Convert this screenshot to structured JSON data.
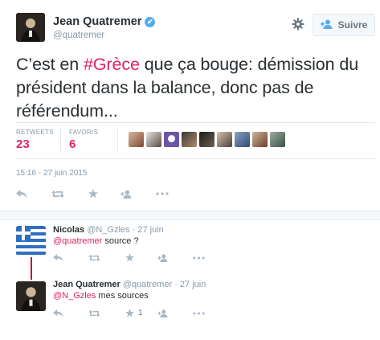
{
  "main_tweet": {
    "author_name": "Jean Quatremer",
    "author_handle": "@quatremer",
    "verified_mark": "✔",
    "follow_label": "Suivre",
    "text_prefix": "C’est en ",
    "hashtag": "#Grèce",
    "text_rest": " que ça bouge: démission du président dans la balance, donc pas de référendum...",
    "retweets_label": "RETWEETS",
    "retweets_count": "23",
    "favorites_label": "FAVORIS",
    "favorites_count": "6",
    "timestamp": "15:16 - 27 juin 2015",
    "icons": [
      "reply-icon",
      "retweet-icon",
      "favorite-icon",
      "follow-icon",
      "more-icon"
    ]
  },
  "replies": [
    {
      "author_name": "Nicolas",
      "author_handle": "@N_Gzles",
      "date": "· 27 juin",
      "mention": "@quatremer",
      "text": " source ?",
      "favorite_count": ""
    },
    {
      "author_name": "Jean Quatremer",
      "author_handle": "@quatremer",
      "date": "· 27 juin",
      "mention": "@N_Gzles",
      "text": " mes sources",
      "favorite_count": "1"
    }
  ],
  "colors": {
    "accent": "#e0245e",
    "verified": "#55acee",
    "muted": "#8899a6",
    "icon": "#aab8c2"
  }
}
